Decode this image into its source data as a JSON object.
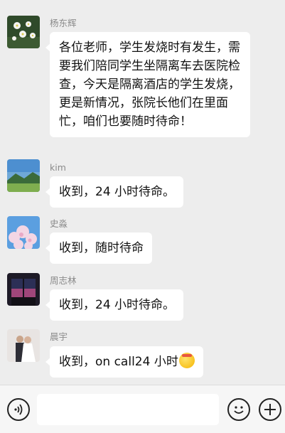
{
  "messages": [
    {
      "sender": "杨东辉",
      "text": "各位老师，学生发烧时有发生，需要我们陪同学生坐隔离车去医院检查，今天是隔离酒店的学生发烧，更是新情况，张院长他们在里面忙，咱们也要随时待命！",
      "avatar": "white-flowers-avatar"
    },
    {
      "sender": "kim",
      "text": "收到，24 小时待命。",
      "avatar": "mountain-landscape-avatar"
    },
    {
      "sender": "史淼",
      "text": "收到，随时待命",
      "avatar": "cherry-blossom-avatar"
    },
    {
      "sender": "周志林",
      "text": "收到，24 小时待命。",
      "avatar": "window-sunset-avatar"
    },
    {
      "sender": "晨宇",
      "text": "收到，on call24 小时",
      "avatar": "wedding-couple-avatar",
      "trailing_emoji": "smiling-face-headband-emoji"
    }
  ],
  "bottom_bar": {
    "left_icon": "voice-input-icon",
    "right_icons": [
      "emoji-icon",
      "plus-icon"
    ]
  },
  "colors": {
    "background": "#ededed",
    "bubble": "#ffffff",
    "sender": "#8a8a8a"
  }
}
